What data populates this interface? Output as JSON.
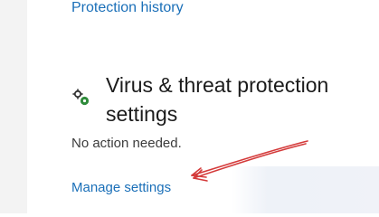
{
  "protection_history": {
    "label": "Protection history"
  },
  "settings_section": {
    "icon": "settings-gear-icon",
    "title": "Virus & threat protection settings",
    "status": "No action needed.",
    "manage_label": "Manage settings"
  },
  "colors": {
    "link": "#1a6fb8",
    "annotation_arrow": "#d43a3a",
    "icon_green": "#2e8b3a"
  }
}
